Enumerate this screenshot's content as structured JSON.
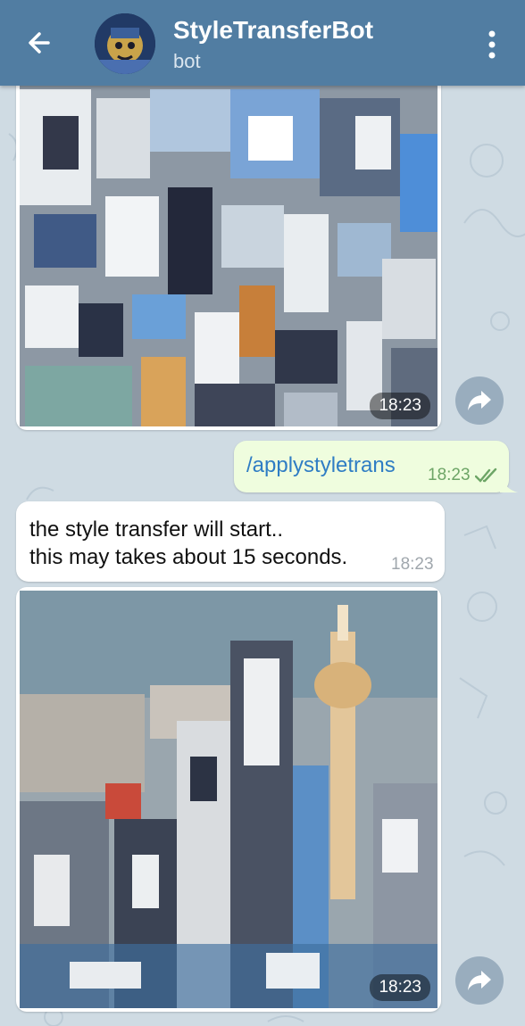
{
  "header": {
    "title": "StyleTransferBot",
    "subtitle": "bot",
    "back_icon": "arrow-left-icon",
    "menu_icon": "more-vertical-icon"
  },
  "messages": [
    {
      "type": "photo",
      "direction": "incoming",
      "time": "18:23",
      "image": "stylized-abstract-cubist-painting"
    },
    {
      "type": "text",
      "direction": "outgoing",
      "text": "/applystyletrans",
      "time": "18:23",
      "status": "read"
    },
    {
      "type": "text",
      "direction": "incoming",
      "lines": [
        "the style transfer will start..",
        "this may takes about 15 seconds."
      ],
      "time": "18:23"
    },
    {
      "type": "photo",
      "direction": "incoming",
      "time": "18:23",
      "image": "stylized-city-skyline-tower"
    }
  ],
  "colors": {
    "header": "#517da2",
    "chat_background": "#cfdbe3",
    "outgoing_bubble": "#effdde",
    "link_text": "#2f7dc4",
    "read_check": "#6da566"
  }
}
